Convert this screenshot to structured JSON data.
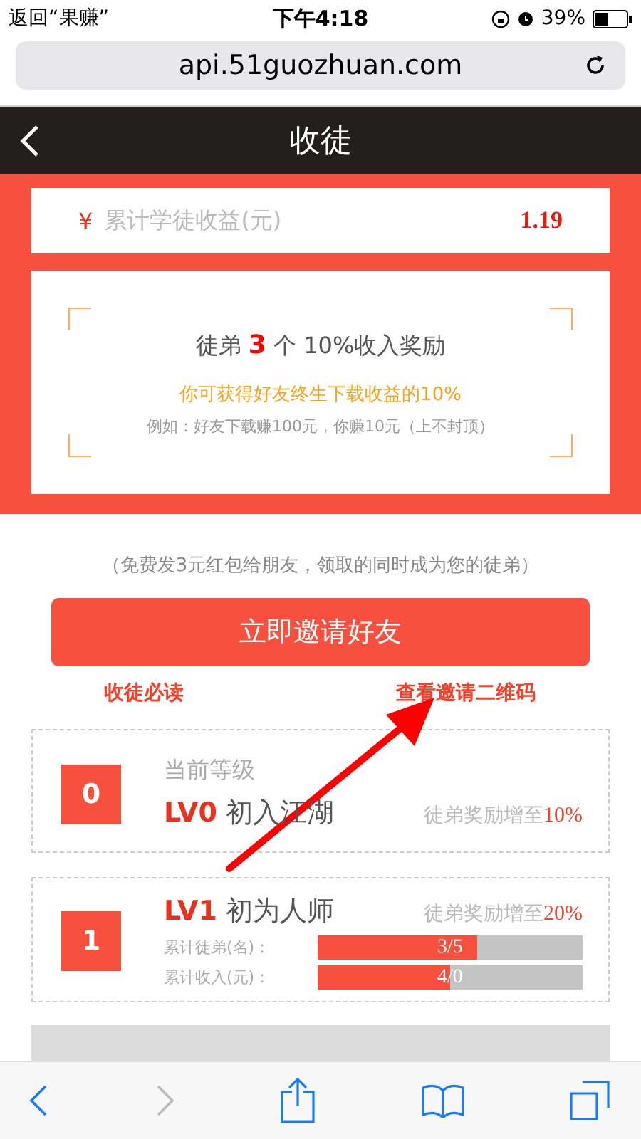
{
  "status_bar": {
    "back_label": "返回“果赚”",
    "time": "下午4:18",
    "battery": "39%"
  },
  "address_bar": {
    "url": "api.51guozhuan.com"
  },
  "header": {
    "title": "收徒"
  },
  "earnings": {
    "currency": "¥",
    "label": "累计学徒收益(元)",
    "value": "1.19"
  },
  "reward": {
    "prefix": "徒弟",
    "count": "3",
    "suffix": "个 10%收入奖励",
    "highlight": "你可获得好友终生下载收益的10%",
    "example": "例如：好友下载赚100元，你赚10元（上不封顶）"
  },
  "invite": {
    "note": "（免费发3元红包给朋友，领取的同时成为您的徒弟）",
    "button": "立即邀请好友",
    "links": [
      "收徒必读",
      "查看邀请二维码"
    ]
  },
  "levels": [
    {
      "kind": "current",
      "badge": "0",
      "caption": "当前等级",
      "code": "LV0",
      "name": "初入江湖",
      "bonus_label": "徒弟奖励增至",
      "bonus": "10%"
    },
    {
      "kind": "next",
      "badge": "1",
      "code": "LV1",
      "name": "初为人师",
      "bonus_label": "徒弟奖励增至",
      "bonus": "20%",
      "progress": [
        {
          "label": "累计徒弟(名)：",
          "reading": "3/5",
          "level": 0.6
        },
        {
          "label": "累计收入(元)：",
          "reading": "4/0",
          "level": 0.5
        }
      ]
    }
  ],
  "toolbar": {
    "back_disabled": false,
    "forward_disabled": true
  }
}
